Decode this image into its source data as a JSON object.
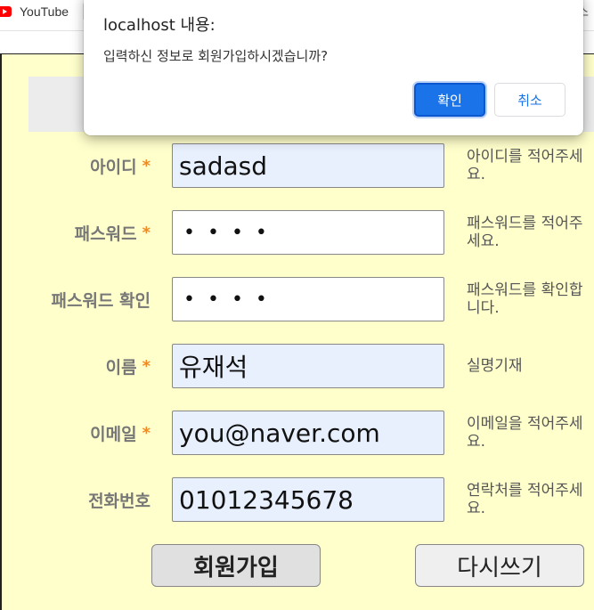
{
  "bookmarks": {
    "youtube_label": "YouTube",
    "right_fragment": "스"
  },
  "dialog": {
    "title": "localhost 내용:",
    "message": "입력하신 정보로 회원가입하시겠습니까?",
    "ok_label": "확인",
    "cancel_label": "취소"
  },
  "form": {
    "required_mark": "*",
    "fields": [
      {
        "label": "아이디",
        "required": true,
        "value": "sadasd",
        "help": "아이디를 적어주세요.",
        "autofill": true
      },
      {
        "label": "패스워드",
        "required": true,
        "value": "••••",
        "help": "패스워드를 적어주세요.",
        "autofill": false
      },
      {
        "label": "패스워드 확인",
        "required": false,
        "value": "••••",
        "help": "패스워드를 확인합니다.",
        "autofill": false
      },
      {
        "label": "이름",
        "required": true,
        "value": "유재석",
        "help": "실명기재",
        "autofill": true
      },
      {
        "label": "이메일",
        "required": true,
        "value": "you@naver.com",
        "help": "이메일을 적어주세요.",
        "autofill": true
      },
      {
        "label": "전화번호",
        "required": false,
        "value": "01012345678",
        "help": "연락처를 적어주세요.",
        "autofill": true
      }
    ],
    "submit_label": "회원가입",
    "reset_label": "다시쓰기"
  },
  "colors": {
    "page_background": "#ffffcc",
    "required_star": "#f08a24",
    "autofill_background": "#e8f0fe",
    "dialog_primary": "#1a73e8"
  }
}
